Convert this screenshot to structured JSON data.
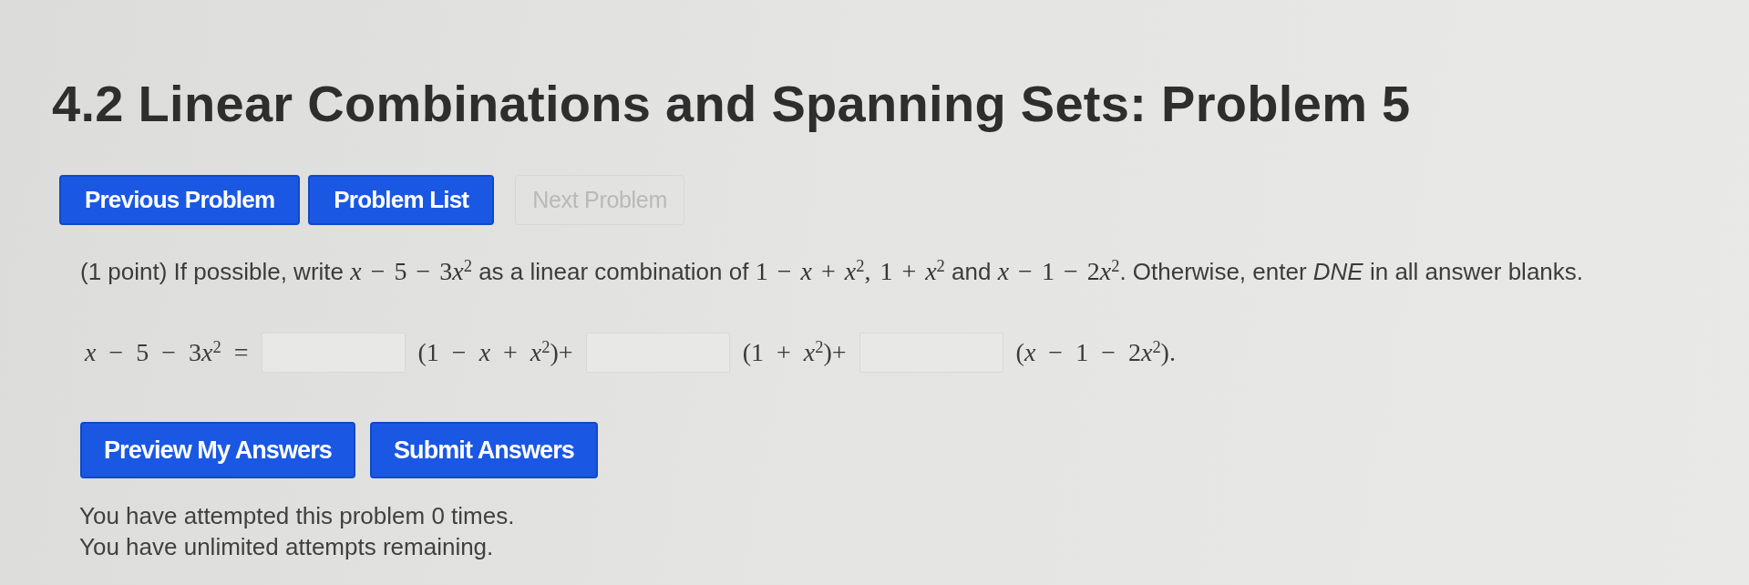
{
  "title": "4.2 Linear Combinations and Spanning Sets: Problem 5",
  "nav_buttons": [
    {
      "label": "Previous Problem",
      "disabled": false
    },
    {
      "label": "Problem List",
      "disabled": false
    },
    {
      "label": "Next Problem",
      "disabled": true
    }
  ],
  "problem": {
    "statement": [
      {
        "kind": "text",
        "text": "(1 point) If possible, write "
      },
      {
        "kind": "math",
        "text": "x − 5 − 3x$^{2}$"
      },
      {
        "kind": "text",
        "text": " as a linear combination of "
      },
      {
        "kind": "math",
        "text": "1 − x + x$^{2}$, 1 + x$^{2}$"
      },
      {
        "kind": "text",
        "text": " and "
      },
      {
        "kind": "math",
        "text": "x − 1 − 2x$^{2}$"
      },
      {
        "kind": "text",
        "text": ". Otherwise, enter *DNE* in all answer blanks."
      }
    ],
    "answer_row": [
      {
        "kind": "math",
        "text": "x − 5 − 3x$^{2}$ ="
      },
      {
        "kind": "blank"
      },
      {
        "kind": "math",
        "text": "(1 − x + x$^{2}$)+"
      },
      {
        "kind": "blank"
      },
      {
        "kind": "math",
        "text": "(1 + x$^{2}$)+"
      },
      {
        "kind": "blank"
      },
      {
        "kind": "math",
        "text": "(x − 1 − 2x$^{2}$)."
      }
    ]
  },
  "action_buttons": [
    "Preview My Answers",
    "Submit Answers"
  ],
  "attempts": [
    "You have attempted this problem 0 times.",
    "You have unlimited attempts remaining."
  ]
}
